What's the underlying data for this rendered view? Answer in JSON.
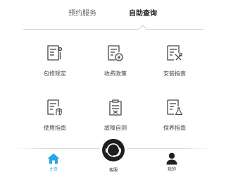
{
  "tabs": [
    {
      "label": "预约服务",
      "active": false
    },
    {
      "label": "自助查询",
      "active": true
    }
  ],
  "grid": [
    {
      "label": "包修规定",
      "icon": "document-wrench-icon"
    },
    {
      "label": "收费政策",
      "icon": "document-yen-icon"
    },
    {
      "label": "安装指南",
      "icon": "document-tools-icon"
    },
    {
      "label": "使用指南",
      "icon": "document-hand-icon"
    },
    {
      "label": "故障自测",
      "icon": "document-checklist-icon"
    },
    {
      "label": "保养指南",
      "icon": "document-flask-icon"
    }
  ],
  "bottom_nav": [
    {
      "label": "主页",
      "icon": "home-icon",
      "active": true
    },
    {
      "label": "客服",
      "icon": "headset-icon",
      "active": false
    },
    {
      "label": "我的",
      "icon": "person-icon",
      "active": false
    }
  ],
  "colors": {
    "accent": "#2aa6e8",
    "text": "#333333",
    "muted": "#666666",
    "divider": "#cfcfcf"
  }
}
